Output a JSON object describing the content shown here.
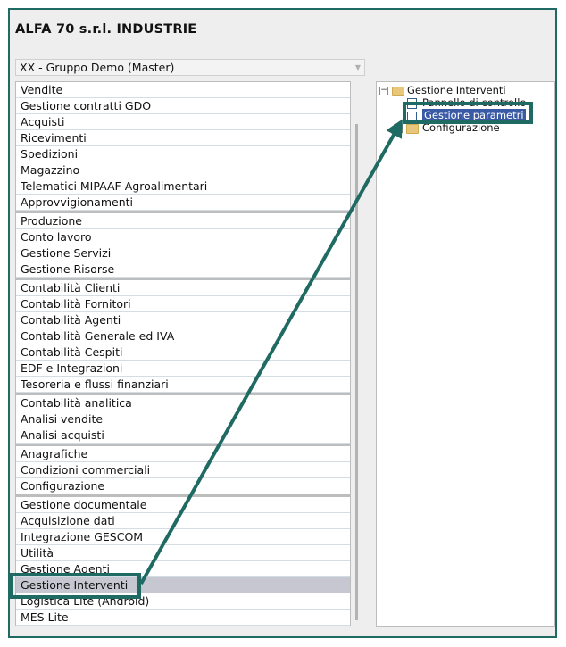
{
  "app": {
    "title": "ALFA 70 s.r.l. INDUSTRIE"
  },
  "company": {
    "selected": "XX - Gruppo Demo (Master)"
  },
  "modules": {
    "groups": [
      [
        "Vendite",
        "Gestione contratti GDO",
        "Acquisti",
        "Ricevimenti",
        "Spedizioni",
        "Magazzino",
        "Telematici MIPAAF Agroalimentari",
        "Approvvigionamenti"
      ],
      [
        "Produzione",
        "Conto lavoro",
        "Gestione Servizi",
        "Gestione Risorse"
      ],
      [
        "Contabilità Clienti",
        "Contabilità Fornitori",
        "Contabilità Agenti",
        "Contabilità Generale ed IVA",
        "Contabilità Cespiti",
        "EDF e Integrazioni",
        "Tesoreria e flussi finanziari"
      ],
      [
        "Contabilità analitica",
        "Analisi vendite",
        "Analisi acquisti"
      ],
      [
        "Anagrafiche",
        "Condizioni commerciali",
        "Configurazione"
      ],
      [
        "Gestione documentale",
        "Acquisizione dati",
        "Integrazione GESCOM",
        "Utilità",
        "Gestione Agenti",
        "Gestione Interventi",
        "Logistica Lite (Android)",
        "MES Lite"
      ]
    ],
    "selected": "Gestione Interventi"
  },
  "tree": {
    "root": "Gestione Interventi",
    "children": [
      "Pannello di controllo",
      "Gestione parametri",
      "Configurazione"
    ],
    "selected": "Gestione parametri"
  },
  "colors": {
    "callout": "#1f6a62",
    "selection": "#c7c7d1",
    "tree_selection": "#3b5aa6"
  }
}
